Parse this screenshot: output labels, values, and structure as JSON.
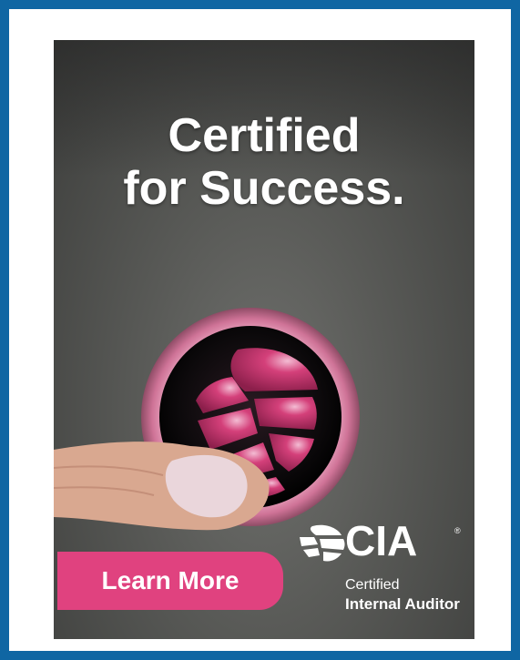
{
  "headline": {
    "line1": "Certified",
    "line2": "for Success."
  },
  "cta": {
    "label": "Learn More"
  },
  "logo": {
    "acronym": "CIA",
    "registered": "®",
    "line1": "Certified",
    "line2": "Internal Auditor"
  },
  "colors": {
    "page_border": "#0f66a3",
    "cta_bg": "#e0427f",
    "brand_pink": "#d6477e"
  },
  "icons": {
    "globe": "cia-globe-icon"
  }
}
